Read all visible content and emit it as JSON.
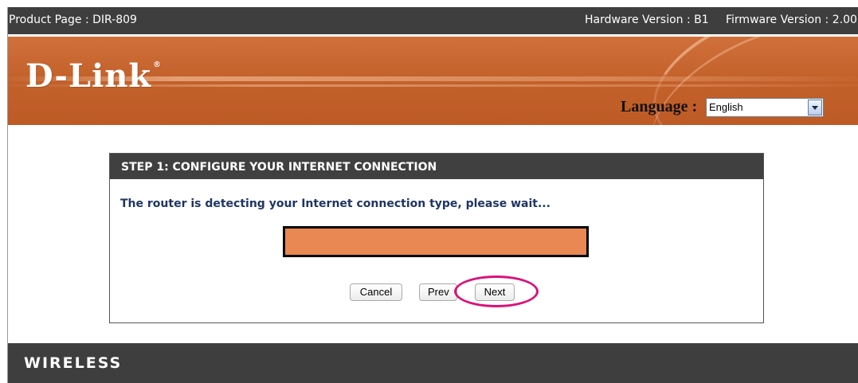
{
  "topbar": {
    "product": "Product Page : DIR-809",
    "hardware": "Hardware Version : B1",
    "firmware": "Firmware Version : 2.00"
  },
  "banner": {
    "logo_text": "D-Link",
    "logo_mark": "®",
    "language_label": "Language :",
    "language_value": "English"
  },
  "wizard": {
    "header": "STEP 1: CONFIGURE YOUR INTERNET CONNECTION",
    "message": "The router is detecting your Internet connection type, please wait...",
    "progress": 1.0,
    "buttons": {
      "cancel": "Cancel",
      "prev": "Prev",
      "next": "Next"
    }
  },
  "footer": {
    "label": "WIRELESS"
  },
  "colors": {
    "topbar_bg": "#3e3e3e",
    "banner_orange": "#c4622c",
    "progress_fill": "#e98852",
    "message_text": "#1f3563",
    "highlight_ring": "#d9127a"
  },
  "icons": {
    "language_dropdown": "chevron-down-icon"
  }
}
